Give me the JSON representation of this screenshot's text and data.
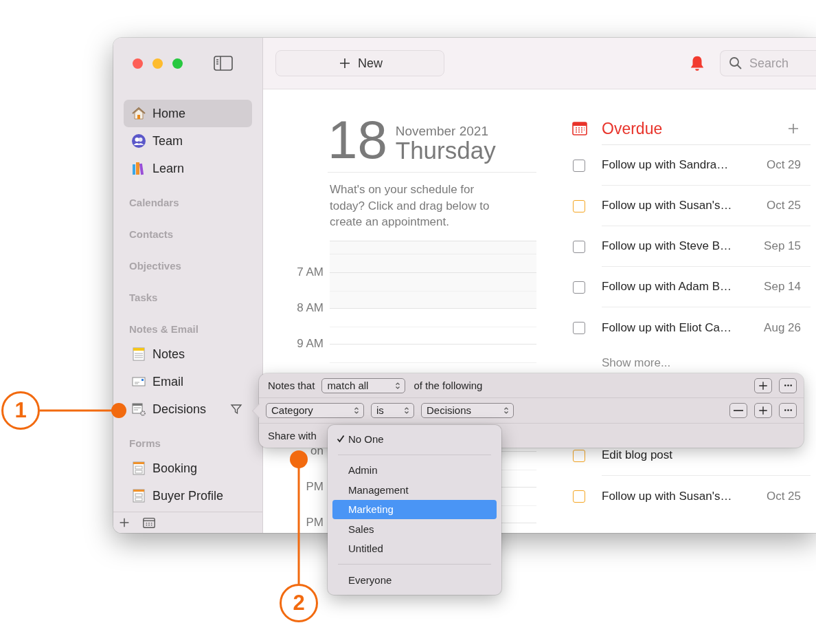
{
  "sidebar": {
    "entries": [
      {
        "kind": "item",
        "label": "Home",
        "selected": true,
        "filtered": false
      },
      {
        "kind": "item",
        "label": "Team",
        "selected": false,
        "filtered": false
      },
      {
        "kind": "item",
        "label": "Learn",
        "selected": false,
        "filtered": false
      },
      {
        "kind": "section",
        "label": "Calendars"
      },
      {
        "kind": "section",
        "label": "Contacts"
      },
      {
        "kind": "section",
        "label": "Objectives"
      },
      {
        "kind": "section",
        "label": "Tasks"
      },
      {
        "kind": "section",
        "label": "Notes & Email"
      },
      {
        "kind": "item",
        "label": "Notes",
        "selected": false,
        "filtered": false
      },
      {
        "kind": "item",
        "label": "Email",
        "selected": false,
        "filtered": false
      },
      {
        "kind": "item",
        "label": "Decisions",
        "selected": false,
        "filtered": true
      },
      {
        "kind": "section",
        "label": "Forms"
      },
      {
        "kind": "item",
        "label": "Booking",
        "selected": false,
        "filtered": false
      },
      {
        "kind": "item",
        "label": "Buyer Profile",
        "selected": false,
        "filtered": false
      }
    ]
  },
  "toolbar": {
    "new_button": "New",
    "search": {
      "placeholder": "Search"
    }
  },
  "day": {
    "date": "18",
    "month_year": "November 2021",
    "weekday": "Thursday",
    "hint": "What's on your schedule for today? Click and drag below to create an appointment.",
    "slots": [
      {
        "kind": "hour",
        "label": "7 AM"
      },
      {
        "kind": "hour",
        "label": "8 AM"
      },
      {
        "kind": "hour",
        "label": "9 AM"
      },
      {
        "kind": "covered"
      },
      {
        "kind": "covered"
      },
      {
        "kind": "hour",
        "label": "on"
      },
      {
        "kind": "hour",
        "label": "PM"
      },
      {
        "kind": "hour",
        "label": "PM"
      }
    ]
  },
  "overdue": {
    "title": "Overdue",
    "tasks": [
      {
        "title": "Follow up with Sandra…",
        "due": "Oct 29",
        "color": "#8e8e93"
      },
      {
        "title": "Follow up with Susan's…",
        "due": "Oct 25",
        "color": "#f5a623"
      },
      {
        "title": "Follow up with Steve B…",
        "due": "Sep 15",
        "color": "#8e8e93"
      },
      {
        "title": "Follow up with Adam B…",
        "due": "Sep 14",
        "color": "#8e8e93"
      },
      {
        "title": "Follow up with Eliot Ca…",
        "due": "Aug 26",
        "color": "#8e8e93"
      }
    ],
    "show_more": "Show more...",
    "later_tasks": [
      {
        "title": "Edit blog post",
        "color": "#f5a623"
      },
      {
        "title": "Follow up with Susan's…",
        "due": "Oct 25",
        "color": "#f5a623"
      }
    ]
  },
  "filter_popover": {
    "rows": [
      {
        "kind": "header",
        "lead": "Notes that",
        "match": "match all",
        "trail": "of the following"
      },
      {
        "kind": "rule",
        "field": "Category",
        "operator": "is",
        "value": "Decisions"
      },
      {
        "kind": "share",
        "label": "Share with"
      }
    ]
  },
  "share_menu": {
    "items": [
      {
        "kind": "item",
        "label": "No One",
        "checked": true,
        "selected": false
      },
      {
        "kind": "separator"
      },
      {
        "kind": "item",
        "label": "Admin",
        "checked": false,
        "selected": false
      },
      {
        "kind": "item",
        "label": "Management",
        "checked": false,
        "selected": false
      },
      {
        "kind": "item",
        "label": "Marketing",
        "checked": false,
        "selected": true
      },
      {
        "kind": "item",
        "label": "Sales",
        "checked": false,
        "selected": false
      },
      {
        "kind": "item",
        "label": "Untitled",
        "checked": false,
        "selected": false
      },
      {
        "kind": "separator"
      },
      {
        "kind": "item",
        "label": "Everyone",
        "checked": false,
        "selected": false
      }
    ]
  },
  "callouts": [
    {
      "number": "1"
    },
    {
      "number": "2"
    }
  ]
}
